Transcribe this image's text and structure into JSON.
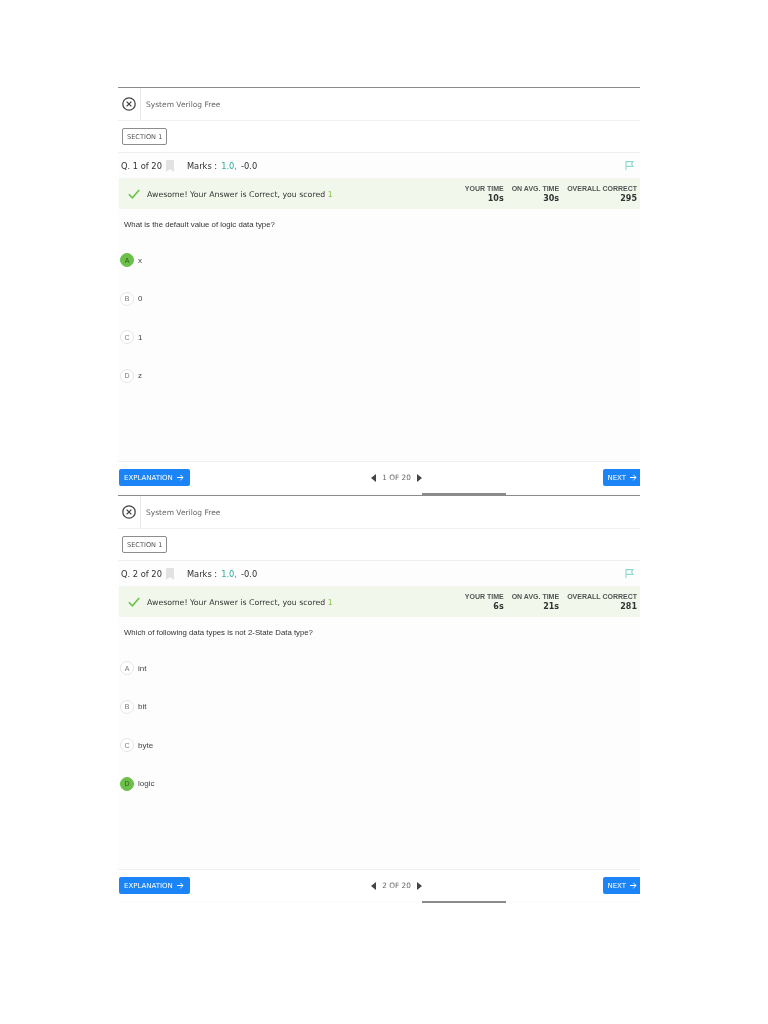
{
  "screens": [
    {
      "header": {
        "title": "System Verilog Free"
      },
      "section_button": "SECTION 1",
      "question_counter": "Q. 1 of 20",
      "marks": {
        "label": "Marks :",
        "positive": "1.0,",
        "negative": "-0.0"
      },
      "result": {
        "message": "Awesome! Your Answer is Correct, you scored",
        "score": "1",
        "stats": [
          {
            "label": "YOUR TIME",
            "value": "10s"
          },
          {
            "label": "ON AVG. TIME",
            "value": "30s"
          },
          {
            "label": "OVERALL CORRECT",
            "value": "295"
          }
        ]
      },
      "question": "What is the default value of logic data type?",
      "options": [
        {
          "letter": "A",
          "text": "x",
          "selected": true
        },
        {
          "letter": "B",
          "text": "0",
          "selected": false
        },
        {
          "letter": "C",
          "text": "1",
          "selected": false
        },
        {
          "letter": "D",
          "text": "z",
          "selected": false
        }
      ],
      "footer": {
        "explanation_button": "EXPLANATION",
        "pager": "1 OF 20",
        "next_button": "NEXT"
      }
    },
    {
      "header": {
        "title": "System Verilog Free"
      },
      "section_button": "SECTION 1",
      "question_counter": "Q. 2 of 20",
      "marks": {
        "label": "Marks :",
        "positive": "1.0,",
        "negative": "-0.0"
      },
      "result": {
        "message": "Awesome! Your Answer is Correct, you scored",
        "score": "1",
        "stats": [
          {
            "label": "YOUR TIME",
            "value": "6s"
          },
          {
            "label": "ON AVG. TIME",
            "value": "21s"
          },
          {
            "label": "OVERALL CORRECT",
            "value": "281"
          }
        ]
      },
      "question": "Which of following data types is not 2-State Data type?",
      "options": [
        {
          "letter": "A",
          "text": "int",
          "selected": false
        },
        {
          "letter": "B",
          "text": "bit",
          "selected": false
        },
        {
          "letter": "C",
          "text": "byte",
          "selected": false
        },
        {
          "letter": "D",
          "text": "logic",
          "selected": true
        }
      ],
      "footer": {
        "explanation_button": "EXPLANATION",
        "pager": "2 OF 20",
        "next_button": "NEXT"
      }
    }
  ]
}
